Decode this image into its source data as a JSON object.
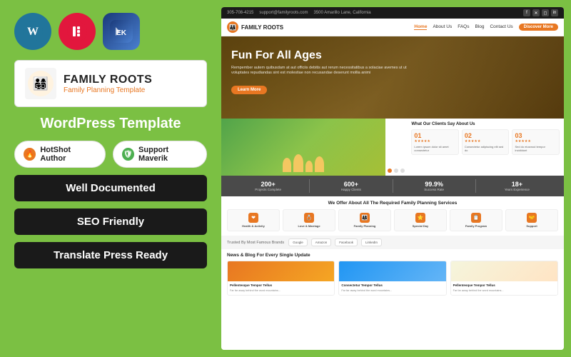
{
  "left": {
    "brand": {
      "name": "FAMILY ROOTS",
      "sub": "Family Planning Template",
      "logo_emoji": "👨‍👩‍👧‍👦"
    },
    "wp_template_label": "WordPress Template",
    "badges": [
      {
        "id": "hotshot",
        "icon": "🔥",
        "icon_type": "fire",
        "label": "HotShot Author"
      },
      {
        "id": "support",
        "icon": "🛡",
        "icon_type": "shield",
        "label": "Support Maverik"
      }
    ],
    "features": [
      {
        "id": "well-documented",
        "label": "Well Documented"
      },
      {
        "id": "seo-friendly",
        "label": "SEO Friendly"
      },
      {
        "id": "translate-press",
        "label": "Translate Press Ready"
      }
    ],
    "icons": [
      {
        "id": "wordpress",
        "letter": "W",
        "color": "#21759b"
      },
      {
        "id": "elementor",
        "letter": "E",
        "color": "#e2173d"
      },
      {
        "id": "ek",
        "letter": "EK",
        "color": "#4a90d9"
      }
    ]
  },
  "preview": {
    "top_bar": {
      "phone": "305-708-4215",
      "email": "support@familyroots.com",
      "address": "3500 Amarillo Lane, California"
    },
    "nav": {
      "logo": "FAMILY ROOTS",
      "links": [
        "Home",
        "About Us",
        "FAQs",
        "Blog",
        "Contact Us"
      ],
      "active": "Home",
      "cta": "Discover More"
    },
    "hero": {
      "title": "Fun For All Ages",
      "text": "Rempember autem quibusdam at aut officiis debitis aut rerum necessitatibus a solaciae avemes ut ut voluptates repudiandas sint est molestiae non recusandae deserunt mollia animi",
      "cta": "Learn More"
    },
    "testimonial": {
      "title": "What Our Clients Say About Us",
      "cards": [
        {
          "num": "01",
          "stars": "★★★★★",
          "text": "Lorem ipsum dolor sit"
        },
        {
          "num": "02",
          "stars": "★★★★★",
          "text": "Consectetur adipiscing"
        },
        {
          "num": "03",
          "stars": "★★★★★",
          "text": "Sed do eiusmod tempor"
        }
      ]
    },
    "stats": [
      {
        "num": "200+",
        "label": "Projects Complete"
      },
      {
        "num": "600+",
        "label": "Happy Clients"
      },
      {
        "num": "99.9%",
        "label": "Success Rate"
      },
      {
        "num": "18+",
        "label": "Years Experience"
      }
    ],
    "services": {
      "title": "We Offer About All The Required Family Planning Services",
      "items": [
        {
          "name": "Health & Activity",
          "icon": "❤"
        },
        {
          "name": "Love & Marriage",
          "icon": "💍"
        },
        {
          "name": "Family Planning",
          "icon": "👨‍👩‍👧"
        },
        {
          "name": "Special Day",
          "icon": "⭐"
        },
        {
          "name": "Family Program",
          "icon": "📋"
        },
        {
          "name": "Support",
          "icon": "🤝"
        }
      ]
    },
    "trusted": {
      "label": "Trusted By Most Famous Brands",
      "brands": [
        "Google",
        "Amazon",
        "Facebook",
        "LinkedIn"
      ]
    },
    "blog": {
      "title": "News & Blog For Every Single Update",
      "posts": [
        {
          "title": "Pellentesque Tempor Tellus",
          "text": "Far far away behind the word mountains..."
        },
        {
          "title": "Consectetur Tempor Tellus",
          "text": "Far far away behind the word mountains..."
        },
        {
          "title": "Pellentesque Tempor Tellus",
          "text": "Far far away behind the word mountains..."
        }
      ]
    }
  }
}
